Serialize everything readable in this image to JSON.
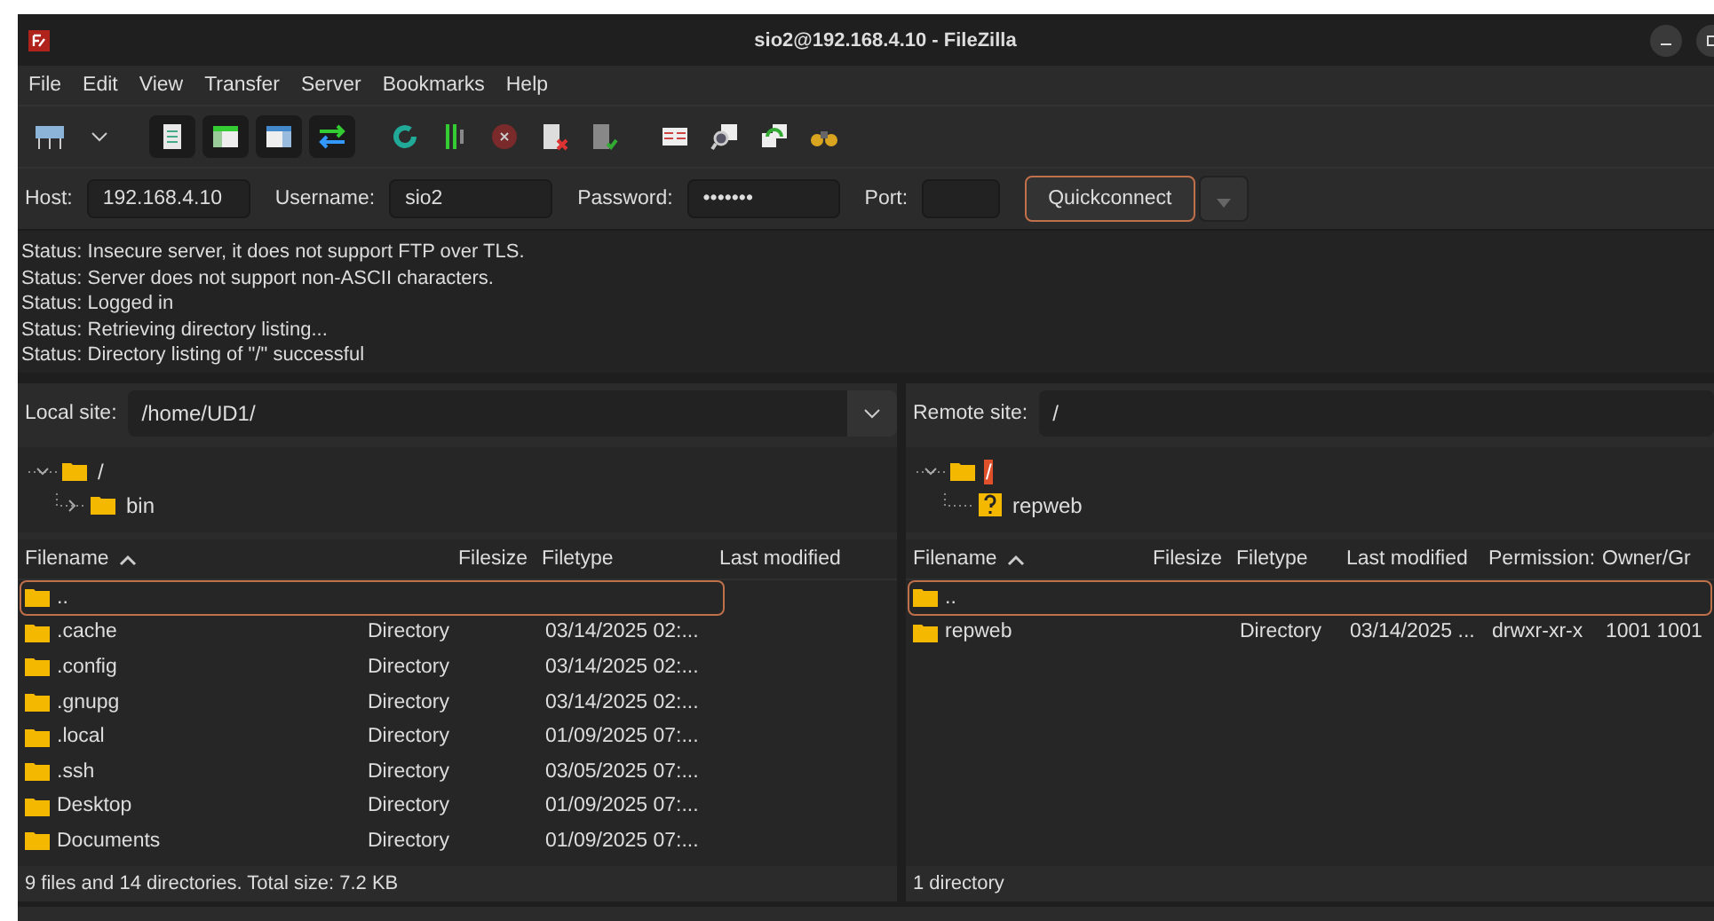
{
  "window": {
    "title": "sio2@192.168.4.10 - FileZilla"
  },
  "menu": [
    "File",
    "Edit",
    "View",
    "Transfer",
    "Server",
    "Bookmarks",
    "Help"
  ],
  "quickconnect": {
    "fields": [
      {
        "label": "Host:",
        "value": "192.168.4.10",
        "kind": "text"
      },
      {
        "label": "Username:",
        "value": "sio2",
        "kind": "text"
      },
      {
        "label": "Password:",
        "value": "•••••••",
        "kind": "password"
      },
      {
        "label": "Port:",
        "kind": "port"
      }
    ],
    "button": "Quickconnect"
  },
  "log": [
    "Status: Insecure server, it does not support FTP over TLS.",
    "Status: Server does not support non-ASCII characters.",
    "Status: Logged in",
    "Status: Retrieving directory listing...",
    "Status: Directory listing of \"/\" successful"
  ],
  "local": {
    "label": "Local site:",
    "path": "/home/UD1/",
    "tree": [
      {
        "label": "/",
        "expanded": true,
        "selected": false,
        "kind": "folder",
        "children": [
          {
            "label": "bin",
            "expanded": false,
            "selected": false,
            "kind": "folder"
          }
        ]
      }
    ],
    "columns": [
      "Filename",
      "Filesize",
      "Filetype",
      "Last modified"
    ],
    "rows": [
      {
        "name": "..",
        "type": "",
        "modified": "",
        "selected": true
      },
      {
        "name": ".cache",
        "type": "Directory",
        "modified": "03/14/2025 02:...",
        "selected": false
      },
      {
        "name": ".config",
        "type": "Directory",
        "modified": "03/14/2025 02:...",
        "selected": false
      },
      {
        "name": ".gnupg",
        "type": "Directory",
        "modified": "03/14/2025 02:...",
        "selected": false
      },
      {
        "name": ".local",
        "type": "Directory",
        "modified": "01/09/2025 07:...",
        "selected": false
      },
      {
        "name": ".ssh",
        "type": "Directory",
        "modified": "03/05/2025 07:...",
        "selected": false
      },
      {
        "name": "Desktop",
        "type": "Directory",
        "modified": "01/09/2025 07:...",
        "selected": false
      },
      {
        "name": "Documents",
        "type": "Directory",
        "modified": "01/09/2025 07:...",
        "selected": false
      }
    ],
    "status": "9 files and 14 directories. Total size: 7.2 KB"
  },
  "remote": {
    "label": "Remote site:",
    "path": "/",
    "tree": [
      {
        "label": "/",
        "expanded": true,
        "selected": true,
        "kind": "folder",
        "children": [
          {
            "label": "repweb",
            "selected": false,
            "kind": "unknown"
          }
        ]
      }
    ],
    "columns": [
      "Filename",
      "Filesize",
      "Filetype",
      "Last modified",
      "Permission:",
      "Owner/Gr"
    ],
    "rows": [
      {
        "name": "..",
        "type": "",
        "modified": "",
        "permissions": "",
        "owner": "",
        "selected": true
      },
      {
        "name": "repweb",
        "type": "Directory",
        "modified": "03/14/2025 ...",
        "permissions": "drwxr-xr-x",
        "owner": "1001 1001",
        "selected": false
      }
    ],
    "status": "1 directory"
  }
}
